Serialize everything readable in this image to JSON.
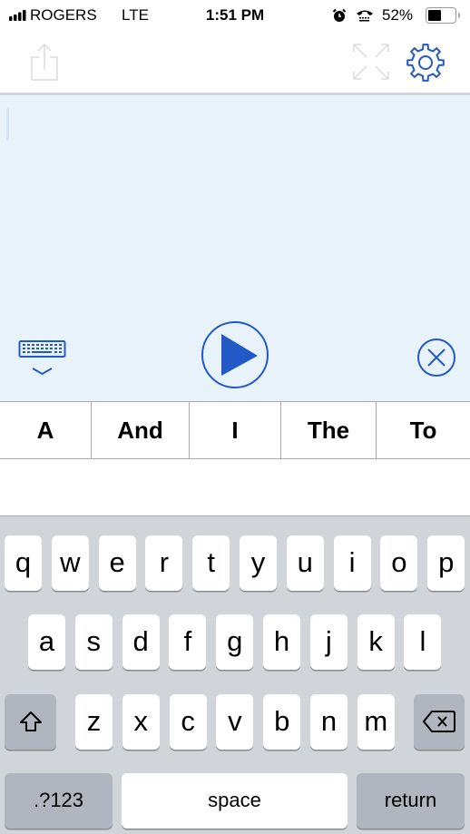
{
  "status_bar": {
    "carrier": "ROGERS",
    "network": "LTE",
    "time": "1:51 PM",
    "battery_percent": "52%",
    "battery_level": 0.52,
    "icons": [
      "signal-icon",
      "alarm-icon",
      "tty-icon",
      "battery-icon"
    ]
  },
  "toolbar": {
    "share_icon": "share-icon",
    "expand_icon": "expand-icon",
    "settings_icon": "gear-icon"
  },
  "editor": {
    "text": "",
    "keyboard_hide_icon": "keyboard-hide-icon",
    "play_icon": "play-icon",
    "clear_icon": "clear-icon"
  },
  "colors": {
    "accent": "#2259c7",
    "editor_bg": "#e8f2fa",
    "keyboard_bg": "#d1d4d9",
    "special_key_bg": "#b0b5bf"
  },
  "suggestions": [
    "A",
    "And",
    "I",
    "The",
    "To"
  ],
  "keyboard": {
    "row1": [
      "q",
      "w",
      "e",
      "r",
      "t",
      "y",
      "u",
      "i",
      "o",
      "p"
    ],
    "row2": [
      "a",
      "s",
      "d",
      "f",
      "g",
      "h",
      "j",
      "k",
      "l"
    ],
    "row3": [
      "z",
      "x",
      "c",
      "v",
      "b",
      "n",
      "m"
    ],
    "shift_icon": "shift-icon",
    "delete_icon": "delete-icon",
    "numbers_label": ".?123",
    "space_label": "space",
    "return_label": "return"
  }
}
